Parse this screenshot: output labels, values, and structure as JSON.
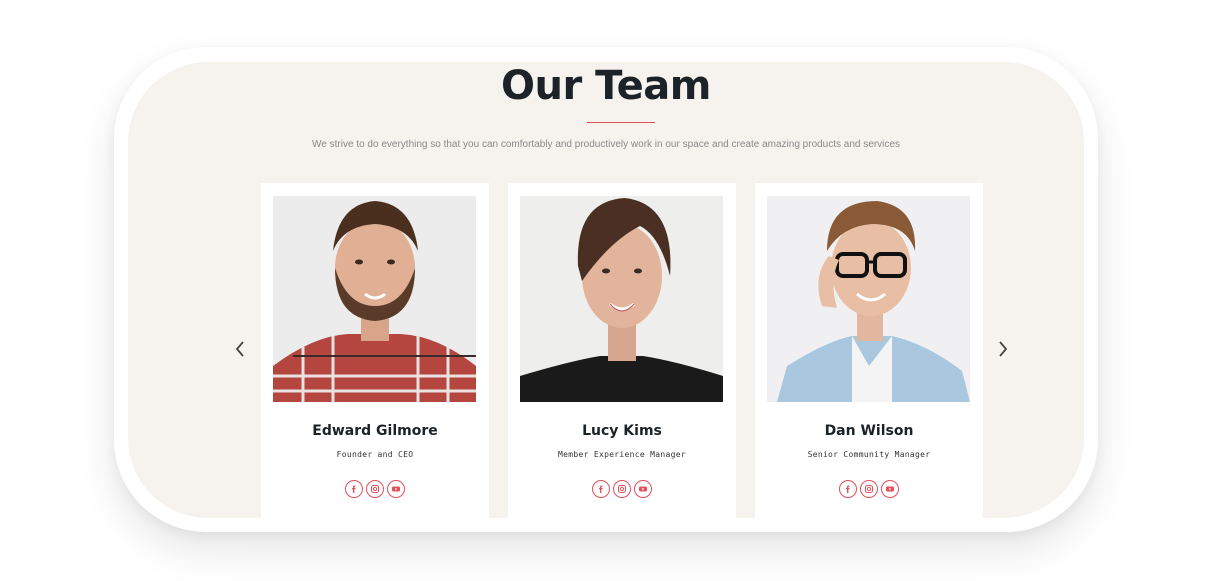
{
  "section": {
    "title": "Our Team",
    "subtitle": "We strive to do everything so that you can comfortably and productively work in our space and create amazing products and services"
  },
  "carousel": {
    "prev_icon": "chevron-left-icon",
    "next_icon": "chevron-right-icon"
  },
  "members": [
    {
      "name": "Edward Gilmore",
      "role": "Founder and CEO",
      "socials": [
        "facebook-icon",
        "instagram-icon",
        "youtube-icon"
      ]
    },
    {
      "name": "Lucy Kims",
      "role": "Member Experience Manager",
      "socials": [
        "facebook-icon",
        "instagram-icon",
        "youtube-icon"
      ]
    },
    {
      "name": "Dan Wilson",
      "role": "Senior Community Manager",
      "socials": [
        "facebook-icon",
        "instagram-icon",
        "youtube-icon"
      ]
    }
  ],
  "colors": {
    "accent": "#e2505c",
    "panel_bg": "#f6f2ee",
    "heading": "#1b2228"
  }
}
